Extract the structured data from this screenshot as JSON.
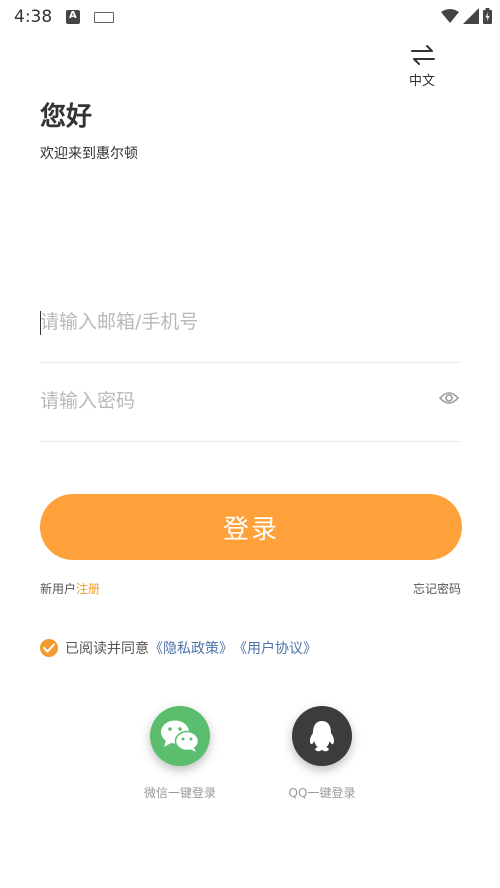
{
  "status_bar": {
    "time": "4:38"
  },
  "language": {
    "label": "中文"
  },
  "header": {
    "greeting": "您好",
    "welcome": "欢迎来到惠尔顿"
  },
  "form": {
    "account_placeholder": "请输入邮箱/手机号",
    "account_value": "",
    "password_placeholder": "请输入密码",
    "password_value": ""
  },
  "login_button": {
    "label": "登录"
  },
  "links": {
    "new_user": "新用户",
    "register": "注册",
    "forgot": "忘记密码"
  },
  "agreement": {
    "checked": true,
    "text": "已阅读并同意",
    "privacy": "《隐私政策》",
    "terms": "《用户协议》"
  },
  "social": {
    "wechat_label": "微信一键登录",
    "qq_label": "QQ一键登录"
  },
  "colors": {
    "accent": "#ffa13b",
    "link": "#4c73a8",
    "wechat": "#5bbd6e",
    "qq": "#3c3c3c"
  }
}
